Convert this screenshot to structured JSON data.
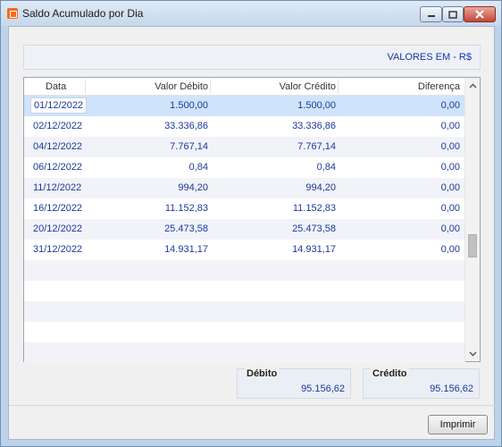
{
  "window": {
    "title": "Saldo Acumulado por Dia"
  },
  "header": {
    "currency_label": "VALORES EM - R$"
  },
  "grid": {
    "columns": [
      "Data",
      "Valor Débito",
      "Valor Crédito",
      "Diferença"
    ],
    "rows": [
      {
        "data": "01/12/2022",
        "debito": "1.500,00",
        "credito": "1.500,00",
        "diferenca": "0,00"
      },
      {
        "data": "02/12/2022",
        "debito": "33.336,86",
        "credito": "33.336,86",
        "diferenca": "0,00"
      },
      {
        "data": "04/12/2022",
        "debito": "7.767,14",
        "credito": "7.767,14",
        "diferenca": "0,00"
      },
      {
        "data": "06/12/2022",
        "debito": "0,84",
        "credito": "0,84",
        "diferenca": "0,00"
      },
      {
        "data": "11/12/2022",
        "debito": "994,20",
        "credito": "994,20",
        "diferenca": "0,00"
      },
      {
        "data": "16/12/2022",
        "debito": "11.152,83",
        "credito": "11.152,83",
        "diferenca": "0,00"
      },
      {
        "data": "20/12/2022",
        "debito": "25.473,58",
        "credito": "25.473,58",
        "diferenca": "0,00"
      },
      {
        "data": "31/12/2022",
        "debito": "14.931,17",
        "credito": "14.931,17",
        "diferenca": "0,00"
      }
    ]
  },
  "totals": {
    "debito_label": "Débito",
    "debito_value": "95.156,62",
    "credito_label": "Crédito",
    "credito_value": "95.156,62"
  },
  "footer": {
    "print_label": "Imprimir"
  }
}
